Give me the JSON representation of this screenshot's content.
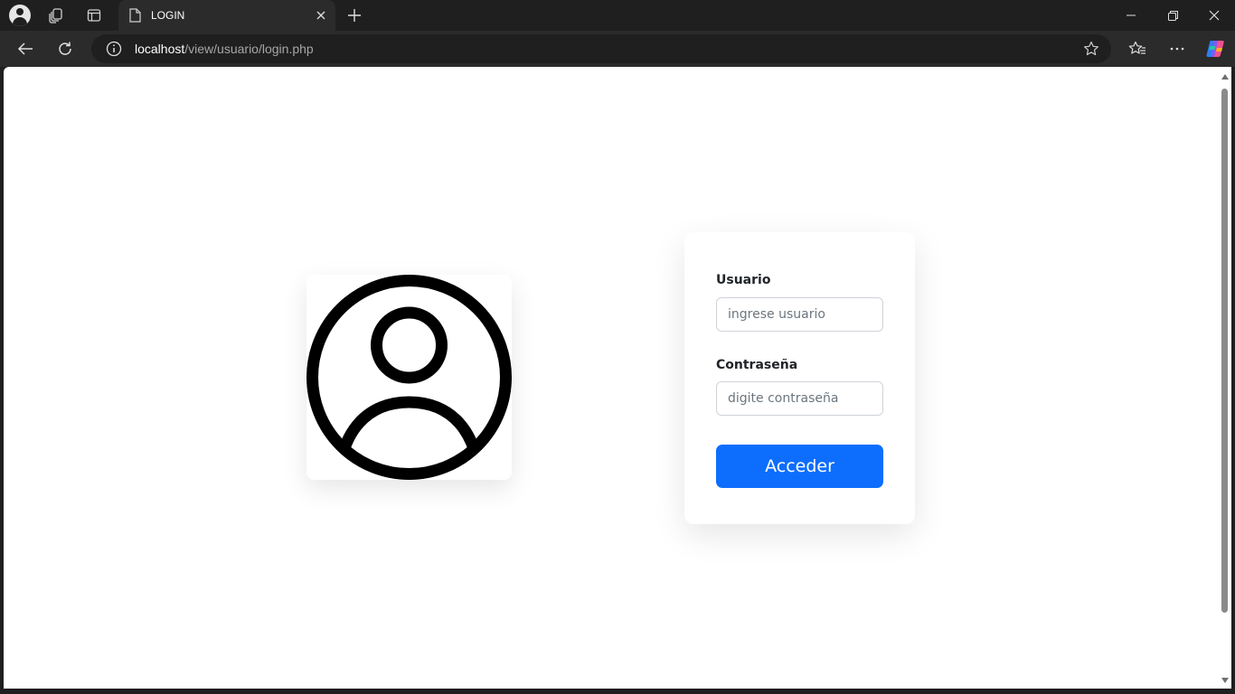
{
  "browser": {
    "tab": {
      "title": "LOGIN",
      "icon": "page-icon"
    },
    "address": {
      "host": "localhost",
      "path": "/view/usuario/login.php"
    },
    "icons": {
      "profile": "profile-icon",
      "workspaces": "workspaces-icon",
      "vertical_tabs": "vertical-tabs-icon",
      "close_tab": "close-icon",
      "new_tab": "plus-icon",
      "minimize": "minimize-icon",
      "restore": "restore-icon",
      "close_window": "close-icon",
      "back": "back-arrow-icon",
      "refresh": "refresh-icon",
      "site_info": "info-icon",
      "favorite": "star-icon",
      "favorites": "favorites-icon",
      "menu": "more-icon",
      "copilot": "copilot-icon"
    }
  },
  "page": {
    "avatar_icon": "user-circle-icon",
    "form": {
      "user_label": "Usuario",
      "user_placeholder": "ingrese usuario",
      "user_value": "",
      "password_label": "Contraseña",
      "password_placeholder": "digite contraseña",
      "password_value": "",
      "submit_label": "Acceder"
    },
    "colors": {
      "primary": "#0d6efd",
      "browser_chrome": "#2b2b2b"
    }
  }
}
